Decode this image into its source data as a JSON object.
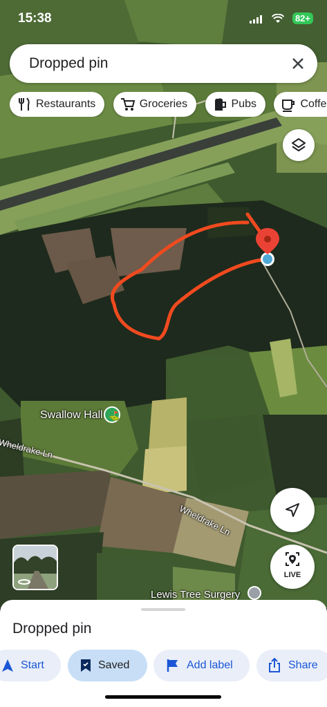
{
  "status_bar": {
    "time": "15:38",
    "battery": "82+"
  },
  "search": {
    "title": "Dropped pin"
  },
  "chips": [
    {
      "label": "Restaurants",
      "icon": "fork-knife-icon"
    },
    {
      "label": "Groceries",
      "icon": "cart-icon"
    },
    {
      "label": "Pubs",
      "icon": "beer-icon"
    },
    {
      "label": "Coffee",
      "icon": "coffee-icon"
    }
  ],
  "map": {
    "labels": {
      "swallow_hall": "Swallow Hall",
      "wheldrake_ln_1": "Wheldrake Ln",
      "wheldrake_ln_2": "Wheldrake Ln",
      "lewis_tree": "Lewis Tree Surgery"
    },
    "pin_color": "#ea4335",
    "route_color": "#f04a1f"
  },
  "controls": {
    "live_label": "LIVE"
  },
  "sheet": {
    "title": "Dropped pin",
    "actions": [
      {
        "label": "Start",
        "icon": "navigation-icon"
      },
      {
        "label": "Saved",
        "icon": "bookmark-icon"
      },
      {
        "label": "Add label",
        "icon": "flag-icon"
      },
      {
        "label": "Share",
        "icon": "share-icon"
      }
    ]
  }
}
